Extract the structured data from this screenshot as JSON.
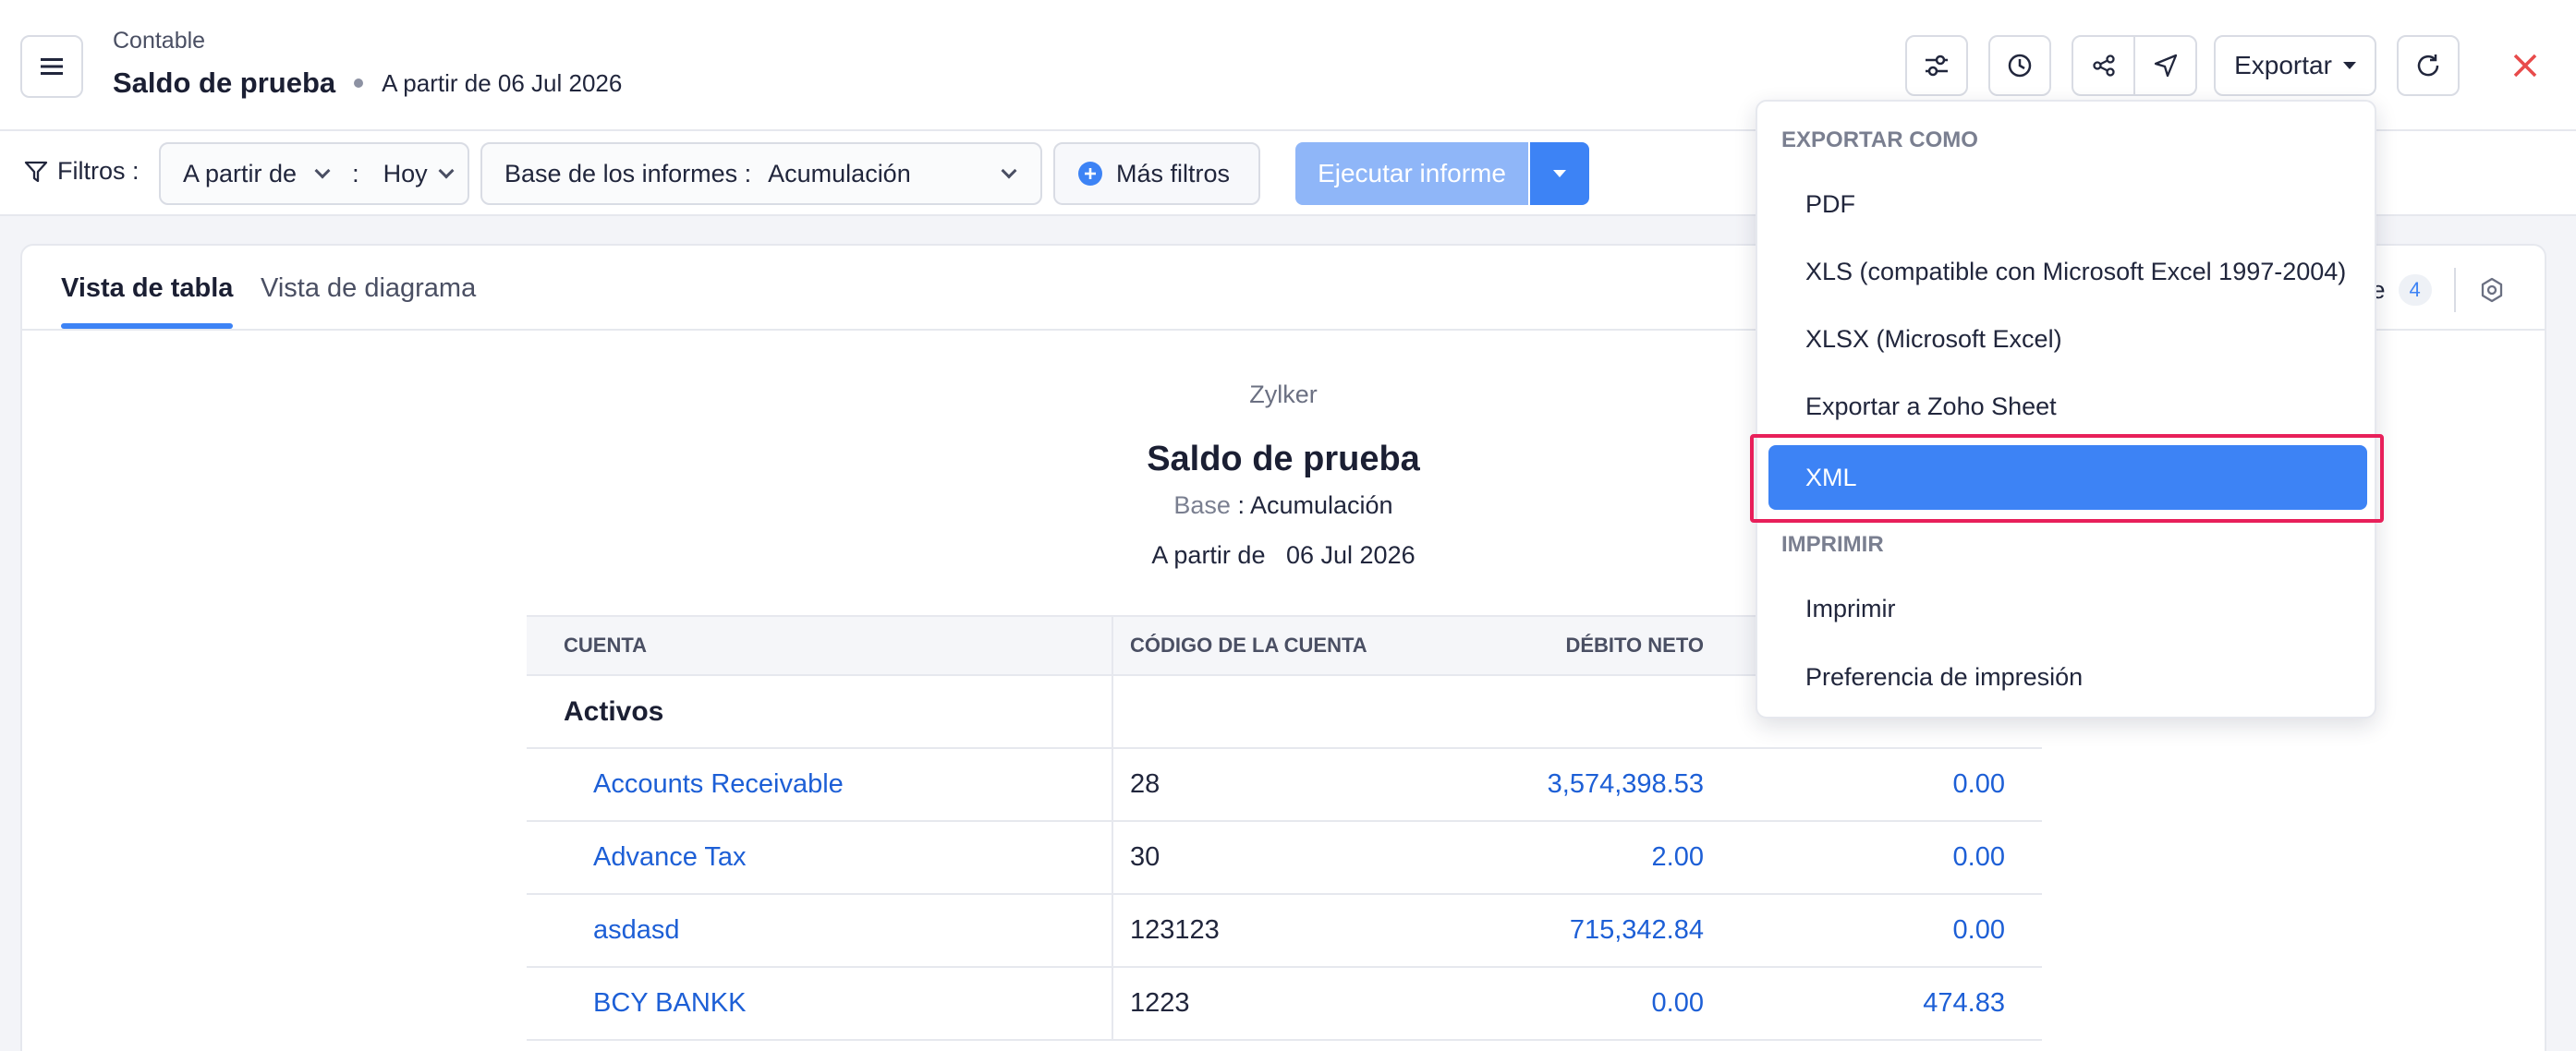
{
  "header": {
    "breadcrumb": "Contable",
    "title": "Saldo de prueba",
    "as_of": "A partir de 06 Jul 2026",
    "export_label": "Exportar"
  },
  "filters": {
    "label": "Filtros :",
    "date_field": "A partir de",
    "date_sep": ":",
    "date_value": "Hoy",
    "basis_label": "Base de los informes :",
    "basis_value": "Acumulación",
    "more_filters": "Más filtros",
    "run_report": "Ejecutar informe"
  },
  "tabs": {
    "table_view": "Vista de tabla",
    "chart_view": "Vista de diagrama",
    "right_partial_label": "me",
    "right_count": "4"
  },
  "report": {
    "org": "Zylker",
    "title": "Saldo de prueba",
    "basis_label": "Base",
    "basis_sep": ":",
    "basis_value": "Acumulación",
    "as_of_label": "A partir de",
    "as_of_date": "06 Jul 2026",
    "columns": [
      "CUENTA",
      "CÓDIGO DE LA CUENTA",
      "DÉBITO NETO",
      ""
    ],
    "group": "Activos",
    "rows": [
      {
        "account": "Accounts Receivable",
        "code": "28",
        "debit": "3,574,398.53",
        "credit": "0.00"
      },
      {
        "account": "Advance Tax",
        "code": "30",
        "debit": "2.00",
        "credit": "0.00"
      },
      {
        "account": "asdasd",
        "code": "123123",
        "debit": "715,342.84",
        "credit": "0.00"
      },
      {
        "account": "BCY BANKK",
        "code": "1223",
        "debit": "0.00",
        "credit": "474.83"
      }
    ]
  },
  "export_menu": {
    "section_export": "EXPORTAR COMO",
    "items_export": [
      "PDF",
      "XLS (compatible con Microsoft Excel 1997-2004)",
      "XLSX (Microsoft Excel)",
      "Exportar a Zoho Sheet",
      "XML"
    ],
    "selected": "XML",
    "section_print": "IMPRIMIR",
    "items_print": [
      "Imprimir",
      "Preferencia de impresión"
    ]
  },
  "colors": {
    "accent": "#3d83f5",
    "run_disabled": "#8fb6f8",
    "link": "#1d5fd6",
    "close": "#e84b4b",
    "highlight": "#e8205a"
  }
}
